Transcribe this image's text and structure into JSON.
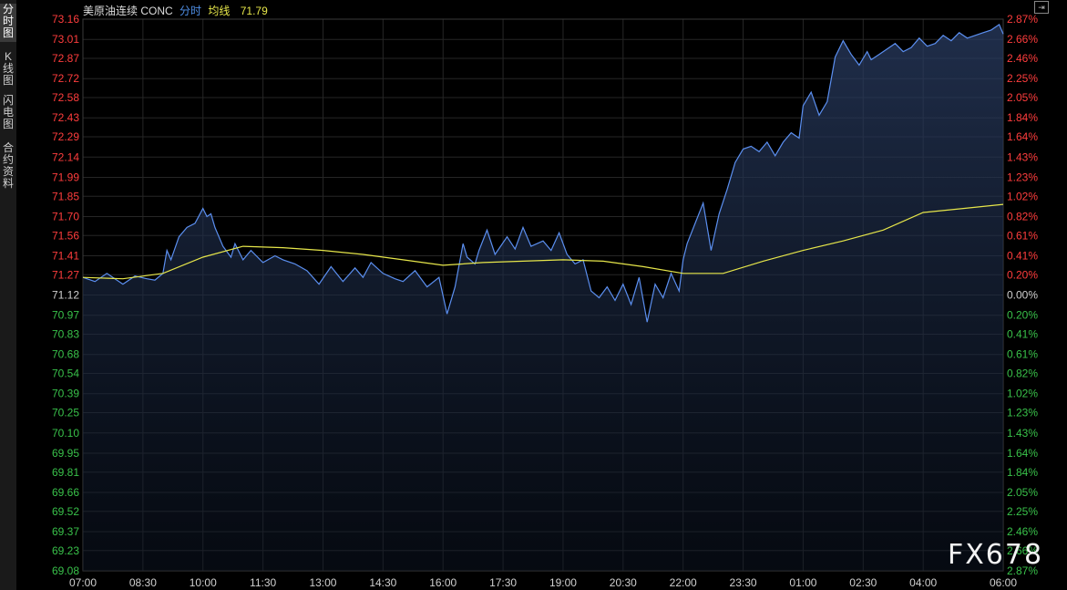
{
  "sidebar": {
    "tabs": [
      {
        "label": "分时图",
        "active": true
      },
      {
        "label": "K线图",
        "active": false
      },
      {
        "label": "闪电图",
        "active": false
      },
      {
        "label": "合约资料",
        "active": false
      }
    ]
  },
  "header": {
    "instrument": "美原油连续 CONC",
    "mode": "分时",
    "avg_label": "均线",
    "avg_value": "71.79"
  },
  "watermark": "FX678",
  "colors": {
    "background": "#000000",
    "grid": "#262626",
    "price_line": "#5b8ff0",
    "avg_line": "#e6e64a",
    "up": "#ff3d3d",
    "down": "#39c14a"
  },
  "chart_data": {
    "type": "line",
    "title": "",
    "xlabel": "",
    "ylabel": "",
    "reference_price": 71.12,
    "ylim": [
      69.08,
      73.16
    ],
    "y_ticks": [
      "73.16",
      "73.01",
      "72.87",
      "72.72",
      "72.58",
      "72.43",
      "72.29",
      "72.14",
      "71.99",
      "71.85",
      "71.70",
      "71.56",
      "71.41",
      "71.27",
      "71.12",
      "70.97",
      "70.83",
      "70.68",
      "70.54",
      "70.39",
      "70.25",
      "70.10",
      "69.95",
      "69.81",
      "69.66",
      "69.52",
      "69.37",
      "69.23",
      "69.08"
    ],
    "pct_ticks": [
      "2.87%",
      "2.66%",
      "2.46%",
      "2.25%",
      "2.05%",
      "1.84%",
      "1.64%",
      "1.43%",
      "1.23%",
      "1.02%",
      "0.82%",
      "0.61%",
      "0.41%",
      "0.20%",
      "0.00%",
      "0.20%",
      "0.41%",
      "0.61%",
      "0.82%",
      "1.02%",
      "1.23%",
      "1.43%",
      "1.64%",
      "1.84%",
      "2.05%",
      "2.25%",
      "2.46%",
      "2.66%",
      "2.87%"
    ],
    "x_ticks": [
      "07:00",
      "08:30",
      "10:00",
      "11:30",
      "13:00",
      "14:30",
      "16:00",
      "17:30",
      "19:00",
      "20:30",
      "22:00",
      "23:30",
      "01:00",
      "02:30",
      "04:00",
      "06:00"
    ],
    "x_tick_hours": [
      0,
      1.5,
      3,
      4.5,
      6,
      7.5,
      9,
      10.5,
      12,
      13.5,
      15,
      16.5,
      18,
      19.5,
      21,
      23
    ],
    "x_range_hours": [
      0,
      23
    ],
    "grid": true,
    "series": [
      {
        "x_hours": [
          0,
          0.3,
          0.6,
          1,
          1.3,
          1.6,
          1.8,
          2,
          2.1,
          2.2,
          2.4,
          2.6,
          2.8,
          3,
          3.1,
          3.2,
          3.3,
          3.5,
          3.7,
          3.8,
          4,
          4.2,
          4.5,
          4.8,
          5,
          5.3,
          5.6,
          5.9,
          6.2,
          6.5,
          6.8,
          7,
          7.2,
          7.5,
          7.8,
          8,
          8.3,
          8.6,
          8.9,
          9.1,
          9.3,
          9.5,
          9.6,
          9.8,
          9.9,
          10.1,
          10.3,
          10.6,
          10.8,
          11,
          11.2,
          11.5,
          11.7,
          11.9,
          12.1,
          12.3,
          12.5,
          12.7,
          12.9,
          13.1,
          13.3,
          13.5,
          13.7,
          13.9,
          14.1,
          14.3,
          14.5,
          14.7,
          14.9,
          15,
          15.1,
          15.3,
          15.5,
          15.7,
          15.9,
          16.1,
          16.3,
          16.5,
          16.7,
          16.9,
          17.1,
          17.3,
          17.5,
          17.7,
          17.9,
          18,
          18.2,
          18.4,
          18.6,
          18.8,
          19,
          19.2,
          19.4,
          19.6,
          19.7,
          19.9,
          20.1,
          20.3,
          20.5,
          20.7,
          20.9,
          21.1,
          21.3,
          21.5,
          21.7,
          21.9,
          22.1,
          22.3,
          22.5,
          22.7,
          22.9,
          23
        ],
        "values": [
          71.25,
          71.22,
          71.28,
          71.2,
          71.26,
          71.24,
          71.23,
          71.28,
          71.45,
          71.38,
          71.55,
          71.62,
          71.65,
          71.76,
          71.7,
          71.72,
          71.62,
          71.48,
          71.4,
          71.5,
          71.38,
          71.45,
          71.36,
          71.41,
          71.38,
          71.35,
          71.3,
          71.2,
          71.33,
          71.22,
          71.32,
          71.25,
          71.36,
          71.28,
          71.24,
          71.22,
          71.3,
          71.18,
          71.25,
          70.98,
          71.18,
          71.5,
          71.4,
          71.35,
          71.45,
          71.6,
          71.42,
          71.55,
          71.46,
          71.62,
          71.48,
          71.52,
          71.45,
          71.58,
          71.42,
          71.35,
          71.38,
          71.15,
          71.1,
          71.18,
          71.08,
          71.2,
          71.05,
          71.25,
          70.92,
          71.2,
          71.1,
          71.28,
          71.15,
          71.38,
          71.5,
          71.65,
          71.8,
          71.45,
          71.72,
          71.9,
          72.1,
          72.2,
          72.22,
          72.18,
          72.25,
          72.15,
          72.25,
          72.32,
          72.28,
          72.52,
          72.62,
          72.45,
          72.55,
          72.88,
          73.0,
          72.9,
          72.82,
          72.92,
          72.86,
          72.9,
          72.94,
          72.98,
          72.92,
          72.95,
          73.02,
          72.96,
          72.98,
          73.04,
          73.0,
          73.06,
          73.02,
          73.04,
          73.06,
          73.08,
          73.12,
          73.05
        ]
      },
      {
        "x_hours": [
          0,
          1,
          2,
          3,
          4,
          5,
          6,
          7,
          8,
          9,
          10,
          11,
          12,
          13,
          14,
          15,
          16,
          17,
          18,
          19,
          20,
          21,
          22,
          23
        ],
        "values": [
          71.25,
          71.24,
          71.28,
          71.4,
          71.48,
          71.47,
          71.45,
          71.42,
          71.38,
          71.34,
          71.36,
          71.37,
          71.38,
          71.37,
          71.33,
          71.28,
          71.28,
          71.37,
          71.45,
          71.52,
          71.6,
          71.73,
          71.76,
          71.79
        ]
      }
    ]
  }
}
